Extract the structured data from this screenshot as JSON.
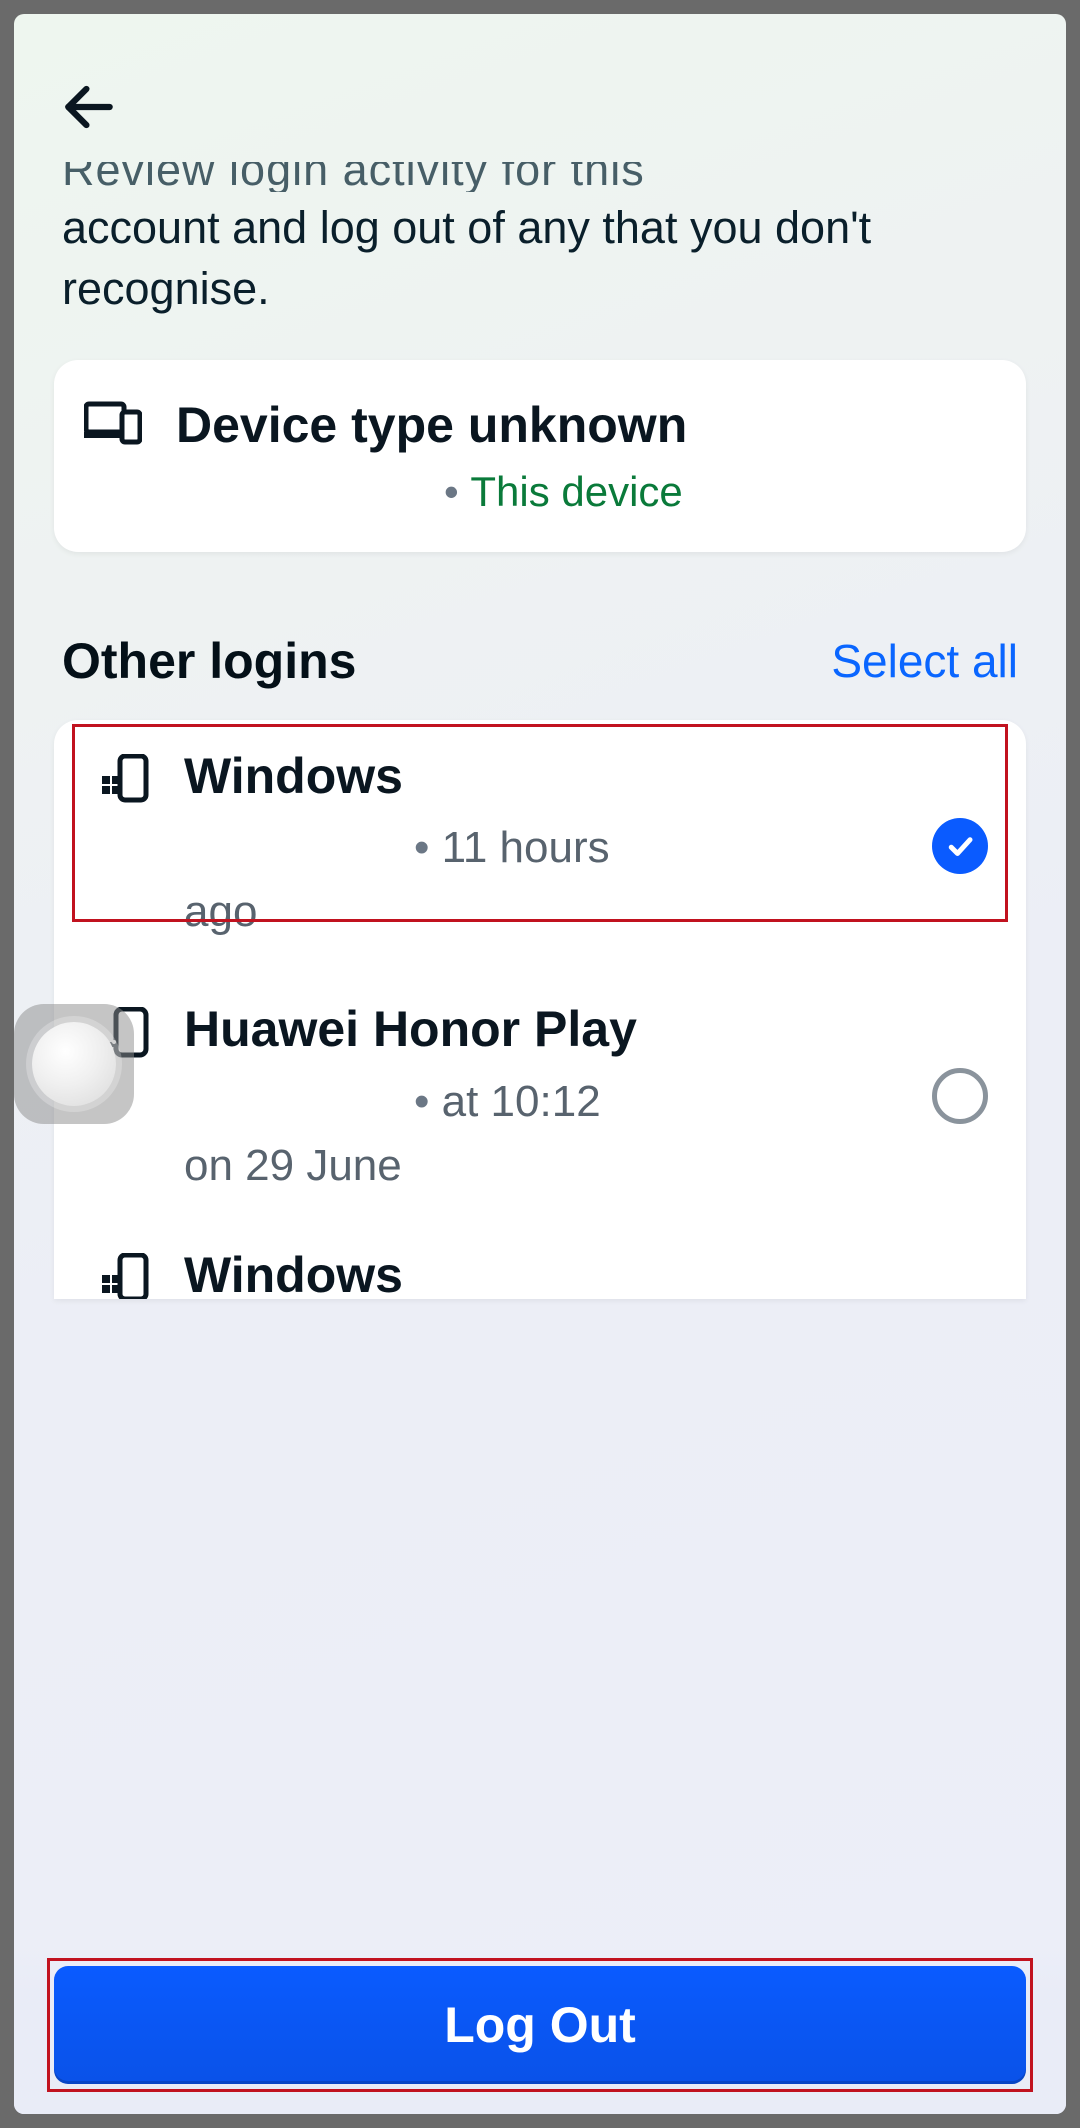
{
  "header": {
    "intro_cut": "Review login activity for this",
    "intro_rest": "account and log out of any that you don't recognise."
  },
  "current_device": {
    "title": "Device type unknown",
    "badge": "This device"
  },
  "section": {
    "other_logins_title": "Other logins",
    "select_all": "Select all"
  },
  "sessions": [
    {
      "name": "Windows",
      "meta1": "11 hours",
      "meta2": "ago",
      "checked": true,
      "icon": "windows",
      "highlighted": true
    },
    {
      "name": "Huawei Honor Play",
      "meta1": "at 10:12",
      "meta2": "on 29 June",
      "checked": false,
      "icon": "android"
    },
    {
      "name": "Windows",
      "meta1": "",
      "meta2": "",
      "checked": false,
      "icon": "windows"
    }
  ],
  "footer": {
    "logout": "Log Out"
  },
  "colors": {
    "accent_blue": "#0a5bff",
    "link_blue": "#0a66ff",
    "green": "#0a7a3a",
    "highlight_red": "#c1121f"
  }
}
